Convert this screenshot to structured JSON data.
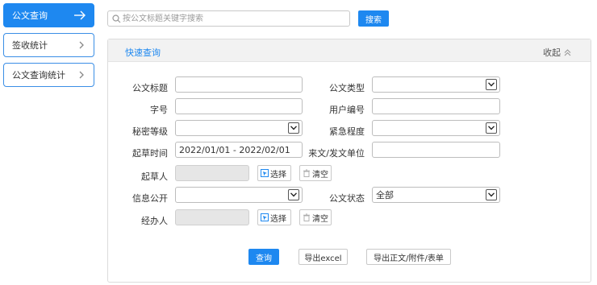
{
  "sidebar": {
    "items": [
      {
        "label": "公文查询",
        "active": true
      },
      {
        "label": "签收统计",
        "active": false
      },
      {
        "label": "公文查询统计",
        "active": false
      }
    ]
  },
  "search": {
    "placeholder": "按公文标题关键字搜索",
    "button_label": "搜索"
  },
  "panel": {
    "title": "快速查询",
    "collapse_label": "收起"
  },
  "form": {
    "doc_title_label": "公文标题",
    "doc_title_value": "",
    "doc_type_label": "公文类型",
    "doc_type_value": "",
    "number_label": "字号",
    "number_value": "",
    "user_number_label": "用户编号",
    "user_number_value": "",
    "secrecy_label": "秘密等级",
    "secrecy_value": "",
    "urgency_label": "紧急程度",
    "urgency_value": "",
    "draft_time_label": "起草时间",
    "draft_time_value": "2022/01/01 - 2022/02/01",
    "unit_label": "来文/发文单位",
    "unit_value": "",
    "drafter_label": "起草人",
    "info_public_label": "信息公开",
    "info_public_value": "",
    "doc_status_label": "公文状态",
    "doc_status_value": "全部",
    "handler_label": "经办人",
    "select_label": "选择",
    "clear_label": "清空"
  },
  "actions": {
    "query_label": "查询",
    "export_excel_label": "导出excel",
    "export_docs_label": "导出正文/附件/表单"
  },
  "colors": {
    "accent": "#1e88f0",
    "sidebar_border": "#3a8ee6",
    "panel_header_bg": "#f2f2f2"
  }
}
